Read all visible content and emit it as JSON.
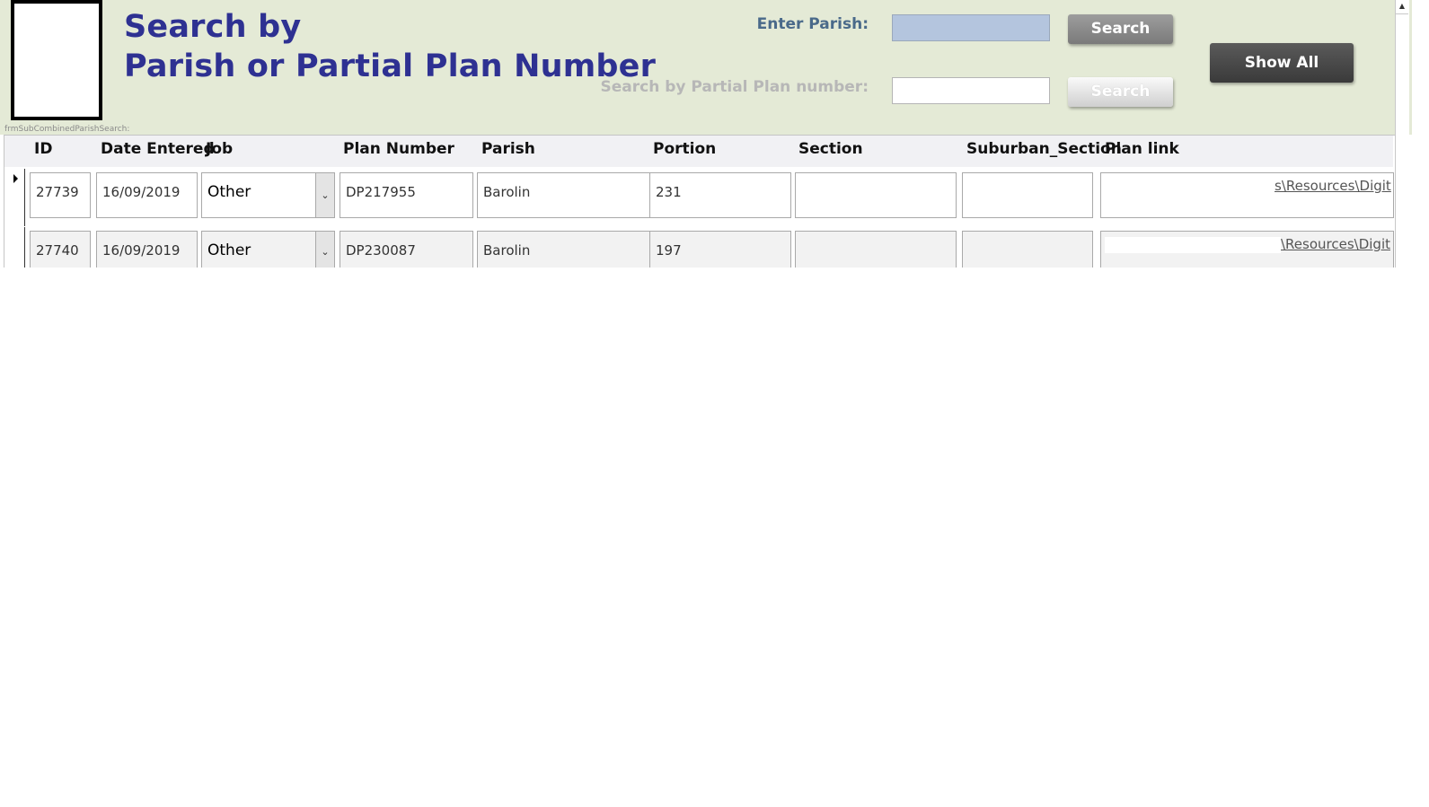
{
  "header": {
    "title_line1": "Search by",
    "title_line2": "Parish or Partial Plan Number",
    "parish_label": "Enter Parish:",
    "parish_value": "",
    "plan_label": "Search by Partial Plan number:",
    "plan_value": "",
    "search_button": "Search",
    "search_plan_button": "Search",
    "show_all_button": "Show All"
  },
  "subform": {
    "name": "frmSubCombinedParishSearch:",
    "columns": [
      "ID",
      "Date Entered",
      "Job",
      "Plan Number",
      "Parish",
      "Portion",
      "Section",
      "Suburban_Section",
      "Plan link"
    ],
    "rows": [
      {
        "id": "27739",
        "date": "16/09/2019",
        "job": "Other",
        "plan_number": "DP217955",
        "parish": "Barolin",
        "portion": "231",
        "section": "",
        "suburban_section": "",
        "plan_link": "s\\Resources\\Digit"
      },
      {
        "id": "27740",
        "date": "16/09/2019",
        "job": "Other",
        "plan_number": "DP230087",
        "parish": "Barolin",
        "portion": "197",
        "section": "",
        "suburban_section": "",
        "plan_link": "\\Resources\\Digit"
      }
    ]
  },
  "colors": {
    "header_bg": "#e4ead6",
    "title": "#2e3192",
    "accent_label": "#4a6a8a"
  }
}
